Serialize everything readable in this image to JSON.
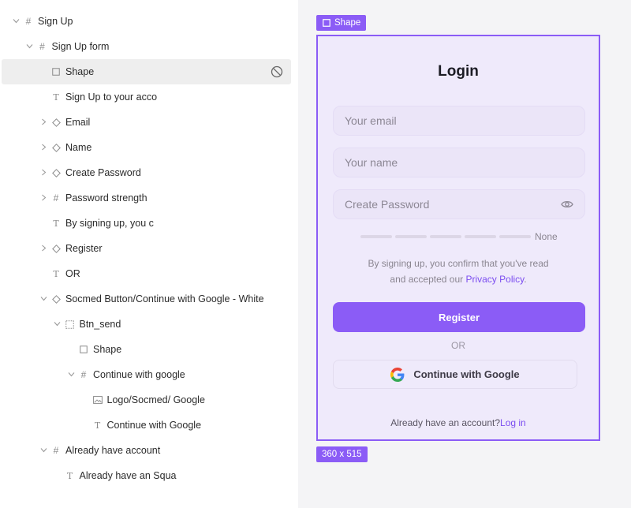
{
  "layers": [
    {
      "label": "Sign Up",
      "type": "frame",
      "chevron": "down",
      "depth": 0
    },
    {
      "label": "Sign Up form",
      "type": "frame",
      "chevron": "down",
      "depth": 1
    },
    {
      "label": "Shape",
      "type": "rect",
      "chevron": "none",
      "depth": 2,
      "selected": true
    },
    {
      "label": "Sign Up to your acco",
      "type": "text",
      "chevron": "none",
      "depth": 2
    },
    {
      "label": "Email",
      "type": "component",
      "chevron": "right",
      "depth": 2
    },
    {
      "label": "Name",
      "type": "component",
      "chevron": "right",
      "depth": 2
    },
    {
      "label": "Create Password",
      "type": "component",
      "chevron": "right",
      "depth": 2
    },
    {
      "label": "Password strength",
      "type": "frame",
      "chevron": "right",
      "depth": 2
    },
    {
      "label": "By signing up, you c",
      "type": "text",
      "chevron": "none",
      "depth": 2
    },
    {
      "label": "Register",
      "type": "component",
      "chevron": "right",
      "depth": 2
    },
    {
      "label": "OR",
      "type": "text",
      "chevron": "none",
      "depth": 2
    },
    {
      "label": "Socmed Button/Continue with Google - White",
      "type": "component",
      "chevron": "down",
      "depth": 2
    },
    {
      "label": "Btn_send",
      "type": "group",
      "chevron": "down",
      "depth": 3
    },
    {
      "label": "Shape",
      "type": "rect",
      "chevron": "none",
      "depth": 4
    },
    {
      "label": "Continue with google",
      "type": "frame",
      "chevron": "down",
      "depth": 4
    },
    {
      "label": "Logo/Socmed/ Google",
      "type": "image",
      "chevron": "none",
      "depth": 5
    },
    {
      "label": "Continue with Google",
      "type": "text",
      "chevron": "none",
      "depth": 5
    },
    {
      "label": "Already have account",
      "type": "frame",
      "chevron": "down",
      "depth": 2
    },
    {
      "label": "Already have an Squa",
      "type": "text",
      "chevron": "none",
      "depth": 3
    }
  ],
  "canvas": {
    "selection_label": "Shape",
    "size_label": "360 x 515"
  },
  "form": {
    "title": "Login",
    "email_placeholder": "Your email",
    "name_placeholder": "Your name",
    "password_placeholder": "Create Password",
    "strength_label": "None",
    "terms_line1": "By signing up, you confirm that you've read",
    "terms_line2_prefix": "and accepted our ",
    "terms_link": "Privacy Policy",
    "terms_suffix": ".",
    "register_label": "Register",
    "or_label": "OR",
    "google_label": "Continue with Google",
    "account_prefix": "Already have an account?",
    "account_link": "Log in"
  },
  "colors": {
    "accent": "#8b5cf6",
    "link": "#7c4ef0",
    "frame_bg": "#efeafb",
    "selected_row": "#eeeeee"
  }
}
